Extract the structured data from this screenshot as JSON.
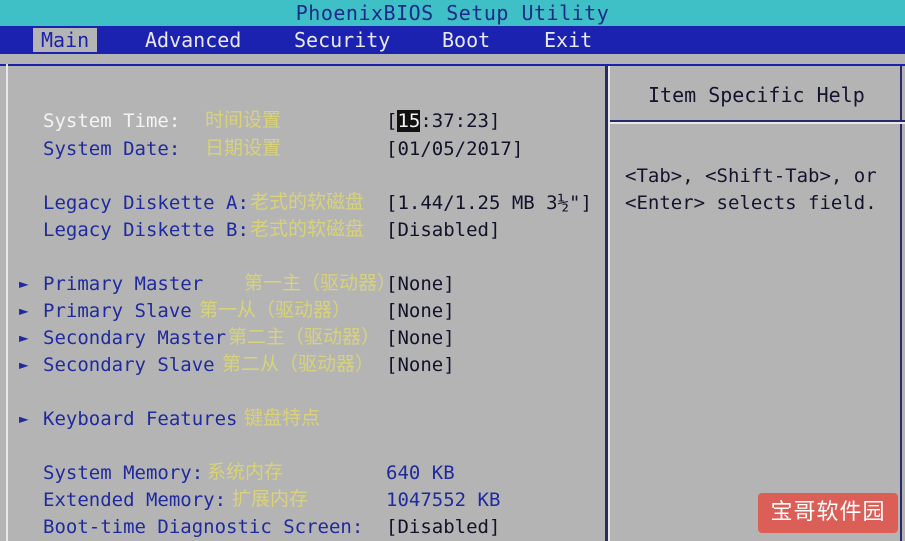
{
  "title": "PhoenixBIOS Setup Utility",
  "menu": {
    "items": [
      "Main",
      "Advanced",
      "Security",
      "Boot",
      "Exit"
    ],
    "active": "Main"
  },
  "main": {
    "system_time": {
      "label": "System Time:",
      "cn": "时间设置",
      "value_hour": "15",
      "value_rest": ":37:23]",
      "value_open": "["
    },
    "system_date": {
      "label": "System Date:",
      "cn": "日期设置",
      "value": "[01/05/2017]"
    },
    "diskette_a": {
      "label": "Legacy Diskette A:",
      "cn": "老式的软磁盘",
      "value": "[1.44/1.25 MB  3½\"]"
    },
    "diskette_b": {
      "label": "Legacy Diskette B:",
      "cn": "老式的软磁盘",
      "value": "[Disabled]"
    },
    "primary_master": {
      "label": "Primary Master",
      "cn": "第一主（驱动器）",
      "value": "[None]"
    },
    "primary_slave": {
      "label": "Primary Slave",
      "cn": "第一从（驱动器）",
      "value": "[None]"
    },
    "secondary_master": {
      "label": "Secondary Master",
      "cn": "第二主（驱动器）",
      "value": "[None]"
    },
    "secondary_slave": {
      "label": "Secondary Slave",
      "cn": "第二从（驱动器）",
      "value": "[None]"
    },
    "keyboard_features": {
      "label": "Keyboard Features",
      "cn": "键盘特点"
    },
    "system_memory": {
      "label": "System Memory:",
      "cn": "系统内存",
      "value": "640 KB"
    },
    "extended_memory": {
      "label": "Extended Memory:",
      "cn": "扩展内存",
      "value": "1047552 KB"
    },
    "boot_diag": {
      "label": "Boot-time Diagnostic Screen:",
      "value": "[Disabled]"
    }
  },
  "help": {
    "title": "Item Specific Help",
    "line1": "<Tab>, <Shift-Tab>, or",
    "line2": "<Enter> selects field."
  },
  "submenu_marker": "►",
  "watermark": "宝哥软件园",
  "colors": {
    "title_bar": "#3ec0c6",
    "menu_bar": "#1c22b0",
    "background": "#b4b4b4",
    "label_blue": "#1f2a9e",
    "chinese_overlay": "#d8d27a"
  }
}
